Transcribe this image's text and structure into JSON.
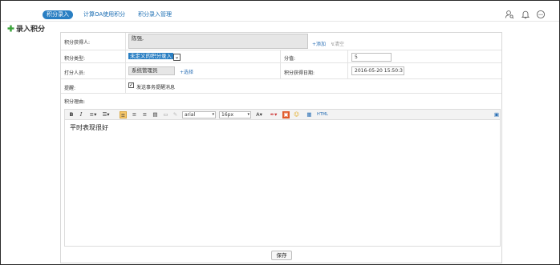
{
  "tabs": [
    {
      "label": "积分录入"
    },
    {
      "label": "计算OA使用积分"
    },
    {
      "label": "积分录入管理"
    }
  ],
  "toolbar_icons": [
    "user-search-icon",
    "bell-icon",
    "chat-icon"
  ],
  "section": {
    "title": "录入积分"
  },
  "form": {
    "recipient": {
      "label": "积分获得人:",
      "value": "陈强,",
      "add_link": "添加",
      "clear_link": "清空"
    },
    "type": {
      "label": "积分类型:",
      "selected": "未定义的积分录入"
    },
    "score": {
      "label": "分值:",
      "value": "5"
    },
    "scorer": {
      "label": "打分人员:",
      "value": "系统管理员",
      "choose_link": "选择"
    },
    "date": {
      "label": "积分获得日期:",
      "value": "2016-05-20 15:50:3"
    },
    "remind": {
      "label": "提醒:",
      "checkbox_label": "发送事务提醒消息",
      "checked": true
    },
    "reason": {
      "label": "积分理由:"
    }
  },
  "editor": {
    "font": "arial",
    "size": "16px",
    "content": "平时表现很好",
    "html_label": "HTML"
  },
  "save_label": "保存",
  "colors": {
    "accent": "#2a7fc3",
    "link": "#2a6fb5"
  }
}
